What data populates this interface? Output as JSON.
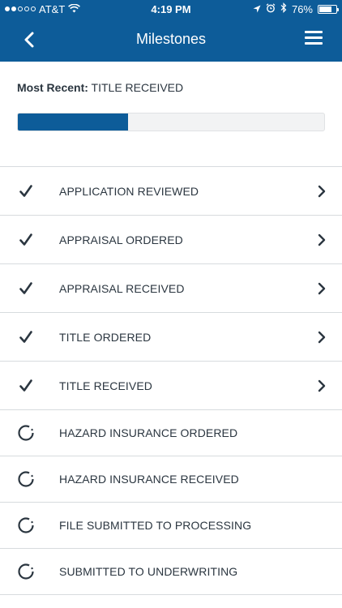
{
  "status_bar": {
    "carrier": "AT&T",
    "time": "4:19 PM",
    "battery": "76%",
    "battery_fraction": 0.76,
    "signal_bars_filled": 2,
    "signal_bars_total": 5,
    "icons": [
      "signal-icon",
      "wifi-icon",
      "location-icon",
      "alarm-icon",
      "bluetooth-icon",
      "battery-icon"
    ]
  },
  "nav": {
    "title": "Milestones",
    "back_icon": "back-chevron-icon",
    "menu_icon": "hamburger-menu-icon"
  },
  "progress": {
    "label": "Most Recent:",
    "value": "TITLE RECEIVED",
    "fraction": 0.36
  },
  "milestones": [
    {
      "label": "APPLICATION REVIEWED",
      "status": "complete",
      "icon": "check-icon"
    },
    {
      "label": "APPRAISAL ORDERED",
      "status": "complete",
      "icon": "check-icon"
    },
    {
      "label": "APPRAISAL RECEIVED",
      "status": "complete",
      "icon": "check-icon"
    },
    {
      "label": "TITLE ORDERED",
      "status": "complete",
      "icon": "check-icon"
    },
    {
      "label": "TITLE RECEIVED",
      "status": "complete",
      "icon": "check-icon"
    },
    {
      "label": "HAZARD INSURANCE ORDERED",
      "status": "pending",
      "icon": "pending-progress-icon"
    },
    {
      "label": "HAZARD INSURANCE RECEIVED",
      "status": "pending",
      "icon": "pending-progress-icon"
    },
    {
      "label": "FILE SUBMITTED TO PROCESSING",
      "status": "pending",
      "icon": "pending-progress-icon"
    },
    {
      "label": "SUBMITTED TO UNDERWRITING",
      "status": "pending",
      "icon": "pending-progress-icon"
    }
  ],
  "colors": {
    "brand": "#0d5c99",
    "text": "#2b3640",
    "divider": "#d7dbde",
    "track": "#f2f3f4"
  }
}
